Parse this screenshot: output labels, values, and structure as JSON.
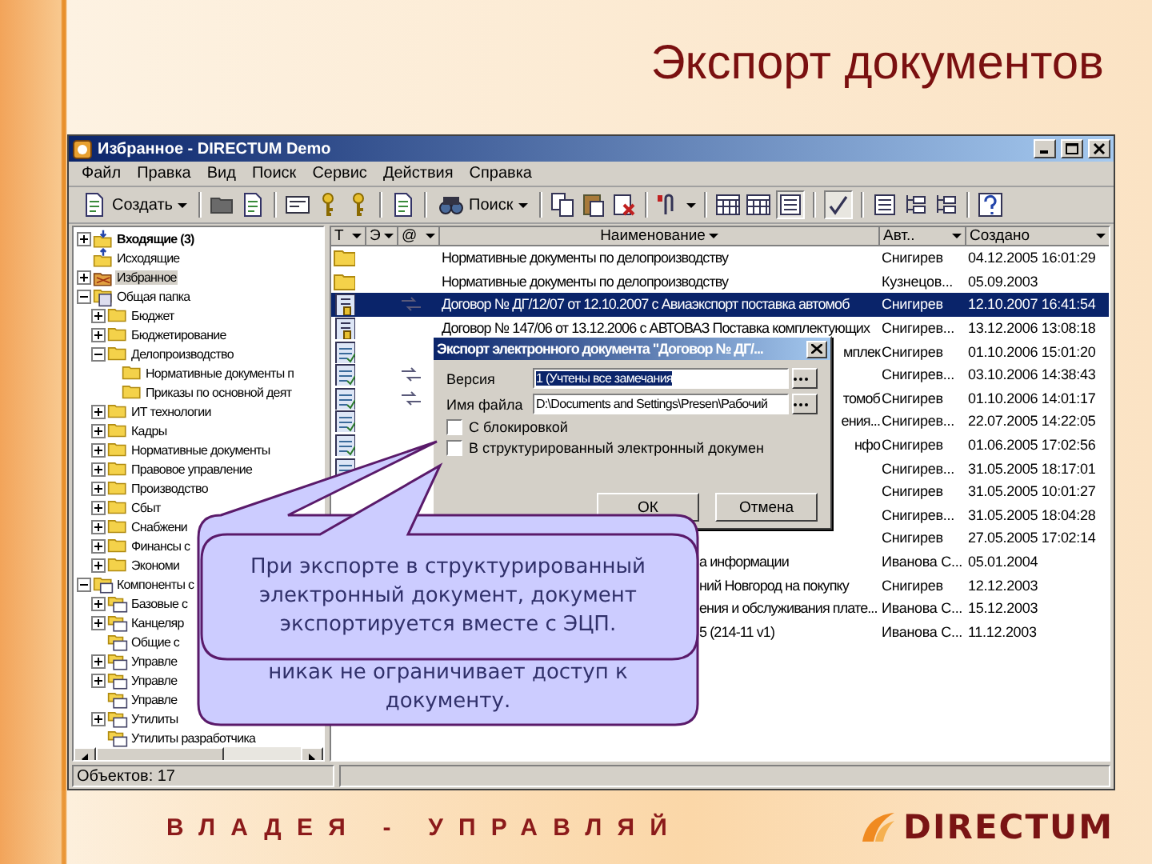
{
  "slide": {
    "title": "Экспорт документов",
    "slogan": "ВЛАДЕЯ - УПРАВЛЯЙ",
    "logo": "DIRECTUM"
  },
  "window": {
    "title": "Избранное - DIRECTUM Demo"
  },
  "menu": [
    "Файл",
    "Правка",
    "Вид",
    "Поиск",
    "Сервис",
    "Действия",
    "Справка"
  ],
  "toolbar": {
    "create": "Создать",
    "search": "Поиск"
  },
  "tree": [
    {
      "label": "Входящие (3)",
      "kind": "inbox",
      "expanded": false,
      "selected": false
    },
    {
      "label": "Исходящие",
      "kind": "outbox",
      "selected": false
    },
    {
      "label": "Избранное",
      "kind": "favorites",
      "expanded": false,
      "selected": true
    },
    {
      "label": "Общая папка",
      "kind": "shared",
      "expanded": true,
      "selected": false,
      "children": [
        {
          "label": "Бюджет",
          "kind": "folder",
          "expanded": false,
          "selected": false
        },
        {
          "label": "Бюджетирование",
          "kind": "folder",
          "expanded": false,
          "selected": false
        },
        {
          "label": "Делопроизводство",
          "kind": "folder",
          "expanded": true,
          "selected": false,
          "children": [
            {
              "label": "Нормативные документы п",
              "kind": "folder",
              "selected": false
            },
            {
              "label": "Приказы по основной деят",
              "kind": "folder",
              "selected": false
            }
          ]
        },
        {
          "label": "ИТ технологии",
          "kind": "folder",
          "expanded": false,
          "selected": false
        },
        {
          "label": "Кадры",
          "kind": "folder",
          "expanded": false,
          "selected": false
        },
        {
          "label": "Нормативные документы",
          "kind": "folder",
          "expanded": false,
          "selected": false
        },
        {
          "label": "Правовое управление",
          "kind": "folder",
          "expanded": false,
          "selected": false
        },
        {
          "label": "Производство",
          "kind": "folder",
          "expanded": false,
          "selected": false
        },
        {
          "label": "Сбыт",
          "kind": "folder",
          "expanded": false,
          "selected": false
        },
        {
          "label": "Снабжени",
          "kind": "folder",
          "expanded": false,
          "selected": false
        },
        {
          "label": "Финансы с",
          "kind": "folder",
          "expanded": false,
          "selected": false
        },
        {
          "label": "Экономи",
          "kind": "folder",
          "expanded": false,
          "selected": false
        }
      ]
    },
    {
      "label": "Компоненты с",
      "kind": "component",
      "expanded": true,
      "selected": false,
      "children": [
        {
          "label": "Базовые с",
          "kind": "module",
          "expanded": false,
          "selected": false
        },
        {
          "label": "Канцеляр",
          "kind": "module",
          "expanded": false,
          "selected": false
        },
        {
          "label": "Общие с",
          "kind": "module",
          "selected": false
        },
        {
          "label": "Управле",
          "kind": "module",
          "expanded": false,
          "selected": false
        },
        {
          "label": "Управле",
          "kind": "module",
          "expanded": false,
          "selected": false
        },
        {
          "label": "Управле",
          "kind": "module",
          "selected": false
        },
        {
          "label": "Утилиты",
          "kind": "module",
          "expanded": false,
          "selected": false
        },
        {
          "label": "Утилиты разработчика",
          "kind": "module",
          "selected": false
        }
      ]
    }
  ],
  "list": {
    "columns": [
      "Т",
      "Э",
      "@",
      "Наименование",
      "Авт..",
      "Создано"
    ],
    "rows": [
      {
        "kind": "folder",
        "linked": false,
        "name": {
          "kind": "whole",
          "text": "Нормативные документы по делопроизводству"
        },
        "author": "Снигирев",
        "created": "04.12.2005 16:01:29",
        "selected": false
      },
      {
        "kind": "folder",
        "linked": false,
        "name": {
          "kind": "whole",
          "text": "Нормативные документы по делопроизводству"
        },
        "author": "Кузнецов...",
        "created": "05.09.2003",
        "selected": false
      },
      {
        "kind": "contract",
        "linked": true,
        "name": {
          "kind": "whole",
          "text": "Договор № ДГ/12/07 от 12.10.2007 с Авиаэкспорт поставка автомоб"
        },
        "author": "Снигирев",
        "created": "12.10.2007 16:41:54",
        "selected": true
      },
      {
        "kind": "contract",
        "linked": false,
        "name": {
          "kind": "whole",
          "text": "Договор № 147/06 от 13.12.2006 с АВТОВАЗ Поставка комплектующих"
        },
        "author": "Снигирев...",
        "created": "13.12.2006 13:08:18",
        "selected": false
      },
      {
        "kind": "document",
        "linked": false,
        "name": {
          "kind": "end",
          "text": "мплек"
        },
        "author": "Снигирев",
        "created": "01.10.2006 15:01:20",
        "selected": false
      },
      {
        "kind": "document",
        "linked": true,
        "author": "Снигирев...",
        "created": "03.10.2006 14:38:43",
        "selected": false
      },
      {
        "kind": "document",
        "linked": true,
        "name": {
          "kind": "end",
          "text": "томоб"
        },
        "author": "Снигирев",
        "created": "01.10.2006 14:01:17",
        "selected": false
      },
      {
        "kind": "document",
        "linked": false,
        "name": {
          "kind": "end",
          "text": "ения..."
        },
        "author": "Снигирев...",
        "created": "22.07.2005 14:22:05",
        "selected": false
      },
      {
        "kind": "document",
        "linked": false,
        "name": {
          "kind": "end",
          "text": "нфо"
        },
        "author": "Снигирев",
        "created": "01.06.2005 17:02:56",
        "selected": false
      },
      {
        "kind": "document",
        "linked": false,
        "author": "Снигирев...",
        "created": "31.05.2005 18:17:01",
        "selected": false
      },
      {
        "kind": "covered",
        "linked": false,
        "author": "Снигирев",
        "created": "31.05.2005 10:01:27",
        "selected": false
      },
      {
        "kind": "covered",
        "linked": false,
        "author": "Снигирев...",
        "created": "31.05.2005 18:04:28",
        "selected": false
      },
      {
        "kind": "covered",
        "linked": false,
        "author": "Снигирев",
        "created": "27.05.2005 17:02:14",
        "selected": false
      },
      {
        "kind": "covered",
        "linked": false,
        "name": {
          "kind": "after_note",
          "text": "а информации"
        },
        "author": "Иванова С...",
        "created": "05.01.2004",
        "selected": false
      },
      {
        "kind": "covered",
        "linked": false,
        "name": {
          "kind": "after_note",
          "text": "ний Новгород на покупку"
        },
        "author": "Снигирев",
        "created": "12.12.2003",
        "selected": false
      },
      {
        "kind": "covered",
        "linked": false,
        "name": {
          "kind": "after_note",
          "text": "ения и обслуживания плате..."
        },
        "author": "Иванова С...",
        "created": "15.12.2003",
        "selected": false
      },
      {
        "kind": "covered",
        "linked": false,
        "name": {
          "kind": "after_note",
          "text": "5 (214-11 v1)"
        },
        "author": "Иванова С...",
        "created": "11.12.2003",
        "selected": false
      }
    ]
  },
  "status_bar": {
    "text": "Объектов: 17"
  },
  "dialog": {
    "title": "Экспорт электронного документа \"Договор № ДГ/...",
    "fields": [
      {
        "label": "Версия",
        "value": "1 (Учтены все замечания",
        "selected": true
      },
      {
        "label": "Имя файла",
        "value": "D:\\Documents and Settings\\Presen\\Рабочий",
        "selected": false
      }
    ],
    "checkboxes": [
      {
        "label": "С блокировкой",
        "checked": false
      },
      {
        "label": "В структурированный электронный докумен",
        "checked": false
      }
    ],
    "buttons": [
      "ОК",
      "Отмена"
    ]
  },
  "callouts": [
    {
      "kind": "front",
      "text": "При экспорте в структурированный электронный документ, документ экспортируется вместе с ЭЦП."
    },
    {
      "kind": "behind",
      "text": "никак не ограничивает доступ к документу."
    }
  ]
}
